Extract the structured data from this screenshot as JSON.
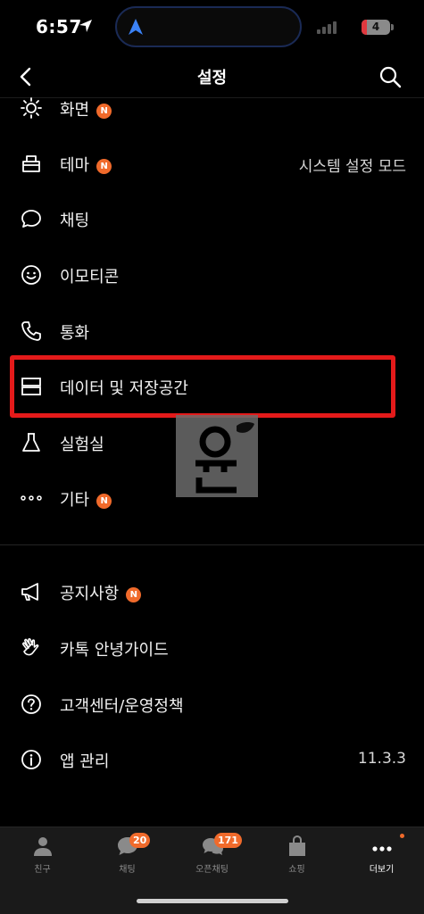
{
  "status": {
    "time": "6:57",
    "battery": "4"
  },
  "header": {
    "title": "설정"
  },
  "menu": {
    "group1": [
      {
        "label": "화면",
        "badge": "N",
        "icon": "brightness-icon"
      },
      {
        "label": "테마",
        "badge": "N",
        "value": "시스템 설정 모드",
        "icon": "theme-icon"
      },
      {
        "label": "채팅",
        "icon": "chat-bubble-icon"
      },
      {
        "label": "이모티콘",
        "icon": "smiley-icon"
      },
      {
        "label": "통화",
        "icon": "phone-icon"
      },
      {
        "label": "데이터 및 저장공간",
        "icon": "storage-icon"
      },
      {
        "label": "실험실",
        "icon": "flask-icon"
      },
      {
        "label": "기타",
        "badge": "N",
        "icon": "more-dots-icon"
      }
    ],
    "group2": [
      {
        "label": "공지사항",
        "badge": "N",
        "icon": "megaphone-icon"
      },
      {
        "label": "카톡 안녕가이드",
        "icon": "wave-hand-icon"
      },
      {
        "label": "고객센터/운영정책",
        "icon": "help-circle-icon"
      },
      {
        "label": "앱 관리",
        "value": "11.3.3",
        "icon": "info-circle-icon"
      }
    ]
  },
  "tabs": [
    {
      "label": "친구",
      "icon": "person-icon"
    },
    {
      "label": "채팅",
      "count": "20",
      "icon": "chat-icon"
    },
    {
      "label": "오픈채팅",
      "count": "171",
      "icon": "open-chat-icon"
    },
    {
      "label": "쇼핑",
      "icon": "shopping-bag-icon"
    },
    {
      "label": "더보기",
      "icon": "more-icon",
      "active": true
    }
  ],
  "colors": {
    "accent": "#f06a2b",
    "highlight": "#e41a1a",
    "background": "#000000"
  }
}
